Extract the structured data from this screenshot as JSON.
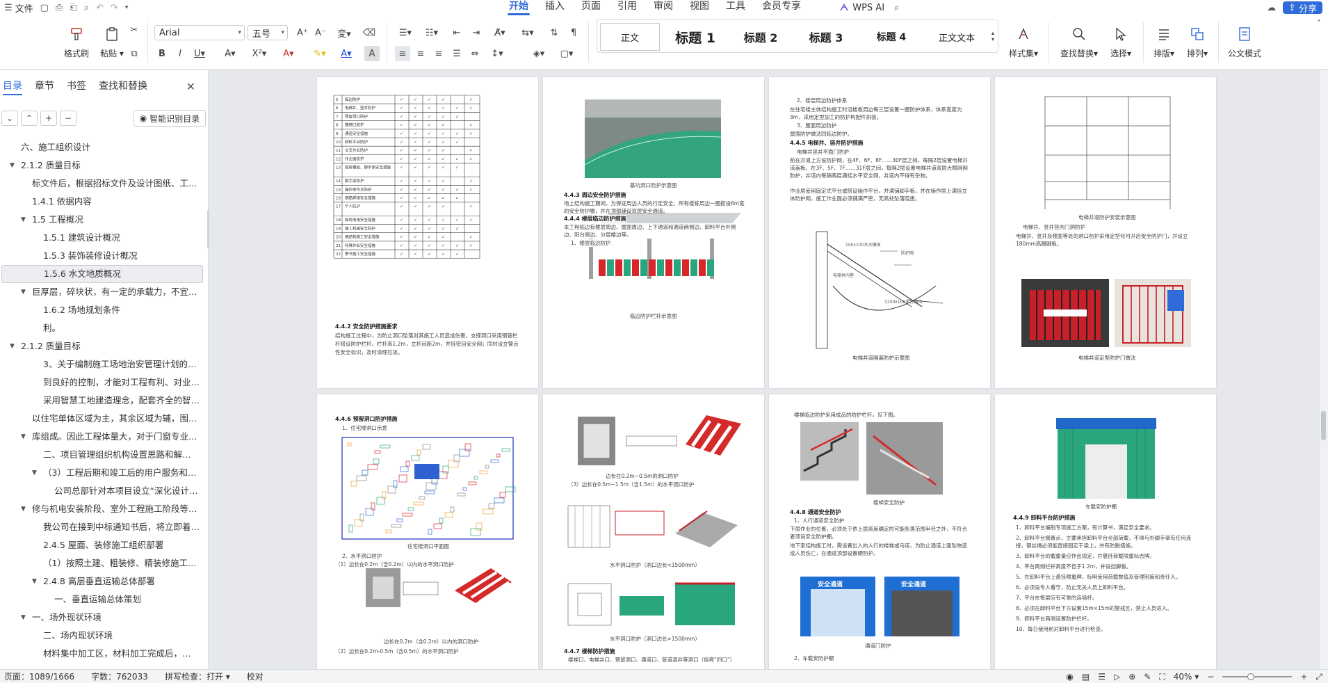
{
  "menu": {
    "file_label": "文件"
  },
  "tabs": [
    "开始",
    "插入",
    "页面",
    "引用",
    "审阅",
    "视图",
    "工具",
    "会员专享"
  ],
  "wps_ai_label": "WPS AI",
  "share_label": "分享",
  "ribbon": {
    "format_painter": "格式刷",
    "paste": "粘贴",
    "font_name": "Arial",
    "font_size": "五号",
    "styles": [
      "正文",
      "标题 1",
      "标题 2",
      "标题 3",
      "标题 4",
      "正文文本"
    ],
    "style_set": "样式集",
    "find_replace": "查找替换",
    "select": "选择",
    "layout": "排版",
    "arrange": "排列",
    "doc_mode": "公文模式"
  },
  "sidebar": {
    "tabs": [
      "目录",
      "章节",
      "书签",
      "查找和替换"
    ],
    "smart_toc": "智能识别目录",
    "toc": [
      {
        "text": "六、施工组织设计",
        "level": 1,
        "arrow": false
      },
      {
        "text": "2.1.2 质量目标",
        "level": 1,
        "arrow": true
      },
      {
        "text": "标文件后，根据招标文件及设计图纸、工程…",
        "level": 2,
        "arrow": false
      },
      {
        "text": "1.4.1 依据内容",
        "level": 2,
        "arrow": false
      },
      {
        "text": "1.5 工程概况",
        "level": 2,
        "arrow": true
      },
      {
        "text": "1.5.1 建筑设计概况",
        "level": 3,
        "arrow": false
      },
      {
        "text": "1.5.3 装饰装修设计概况",
        "level": 3,
        "arrow": false
      },
      {
        "text": "1.5.6 水文地质概况",
        "level": 3,
        "arrow": false,
        "selected": true
      },
      {
        "text": "巨厚层，碎块状，有一定的承载力，不宜作…",
        "level": 2,
        "arrow": true
      },
      {
        "text": "1.6.2 场地规划条件",
        "level": 3,
        "arrow": false
      },
      {
        "text": "利。",
        "level": 3,
        "arrow": false
      },
      {
        "text": "2.1.2 质量目标",
        "level": 1,
        "arrow": true
      },
      {
        "text": "3、关于编制施工场地治安管理计划的约…",
        "level": 3,
        "arrow": false
      },
      {
        "text": "到良好的控制，才能对工程有利、对业…",
        "level": 3,
        "arrow": false
      },
      {
        "text": "采用智慧工地建造理念，配套齐全的智…",
        "level": 3,
        "arrow": false
      },
      {
        "text": "以住宅单体区域为主，其余区域为辅，围绕…",
        "level": 2,
        "arrow": false
      },
      {
        "text": "库组成。因此工程体量大，对于门窗专业、…",
        "level": 2,
        "arrow": true
      },
      {
        "text": "二、项目管理组织机构设置思路和解…",
        "level": 3,
        "arrow": false
      },
      {
        "text": "（3）工程后期和竣工后的用户服务和保…",
        "level": 3,
        "arrow": true
      },
      {
        "text": "公司总部针对本项目设立“深化设计…",
        "level": 4,
        "arrow": false
      },
      {
        "text": "修与机电安装阶段、室外工程施工阶段等不…",
        "level": 2,
        "arrow": true
      },
      {
        "text": "我公司在接到中标通知书后，将立即着…",
        "level": 3,
        "arrow": false
      },
      {
        "text": "2.4.5 屋面、装修施工组织部署",
        "level": 3,
        "arrow": false
      },
      {
        "text": "（1）按照土建、粗装修、精装修施工进…",
        "level": 3,
        "arrow": false
      },
      {
        "text": "2.4.8 高层垂直运输总体部署",
        "level": 3,
        "arrow": true
      },
      {
        "text": "一、垂直运输总体策划",
        "level": 4,
        "arrow": false
      },
      {
        "text": "一、场外现状环境",
        "level": 2,
        "arrow": true
      },
      {
        "text": "二、场内现状环境",
        "level": 3,
        "arrow": false
      },
      {
        "text": "材料集中加工区，材料加工完成后，…",
        "level": 3,
        "arrow": false
      }
    ]
  },
  "pages": {
    "p1": {
      "rows": [
        "5",
        "6",
        "7",
        "8",
        "9",
        "10",
        "11",
        "12",
        "13",
        "14",
        "15",
        "16",
        "17",
        "18",
        "19",
        "20",
        "21",
        "22"
      ],
      "row_labels": [
        "临边防护",
        "电梯井、竖井防护",
        "预留洞口防护",
        "楼梯口防护",
        "通道安全措施",
        "卸料平台防护",
        "交叉作业防护",
        "作业面防护",
        "搭拆模板、脚手架安全措施",
        "脚手架防护",
        "操作架作业防护",
        "钢筋焊接安全措施",
        "个人防护",
        "临时用电安全措施",
        "施工机械安全防护",
        "钢结构施工安全措施",
        "特殊作业安全措施",
        "季节施工安全措施"
      ],
      "heading": "4.4.2 安全防护措施要求",
      "body": "结构施工过程中，为防止洞口坠落对其施工人员造成伤害，支撑洞口采用钢管栏杆搭设防护栏杆，栏杆高1.2m，立杆间距2m，并挂密目安全网；同时设立警示性安全标识，及时清理垃圾。"
    },
    "p2": {
      "caption1": "基坑洞口防护示意图",
      "h1": "4.4.3 周边安全防护措施",
      "t1": "地上结构施工期间，为保证周边人员的行走安全，所有楼栋周边一圈搭设6m宽的安全防护棚，并在顶部铺设双层安全通道。",
      "h2": "4.4.4 楼层临边防护措施",
      "t2": "本工程临边有楼层周边、屋面周边、上下通道和通道两侧边、卸料平台外侧边、阳台侧边、分层楼边等。",
      "sub": "1、楼层临边防护",
      "caption2": "临边防护栏杆示意图"
    },
    "p3": {
      "t1": "2、楼层周边防护体系",
      "t2": "在住宅楼主体结构施工时沿楼板周边每三层设置一圈防护体系，体系宽度为3m，采用定型加工的防护构配件拼装。",
      "t3": "3、屋面周边防护",
      "t4": "屋面防护做法同临边防护。",
      "h1": "4.4.5 电梯井、竖井防护措施",
      "t5": "电梯井竖井平面门防护",
      "t6": "前在井道上方设防护网，在4F、6F、8F……30F层之间，每隔2层设置电梯井道盖板。在3F、5F、7F……31F层之间，每隔2层设置电梯井道双层大眼网网防护，井道内每隔两层满挂水平安全网，井道内不得有杂物。",
      "t7": "作业层使用固定式平台或搭设操作平台，并满铺脚手板，并在操作层上满挂立体防护网，施工作业面必须铺满严密，无高处坠落隐患。",
      "caption": "电梯井道隔离防护示意图",
      "labels": [
        "100x100木方横挡",
        "防护网",
        "电梯井内壁",
        "1200x100木方横挡"
      ]
    },
    "p4": {
      "caption1": "电梯井道防护安装示意图",
      "t1": "电梯井、竖井竖向门洞防护",
      "t2": "电梯井、竖井及楼面等处的洞口防护采用定型化可开启安全防护门，并设立180mm高踢脚板。",
      "caption2": "电梯井道定型防护门做法"
    },
    "p5": {
      "h1": "4.4.6 预留洞口防护措施",
      "t1": "1、住宅楼洞口示意",
      "caption1": "住宅楼洞口平面图",
      "t2": "2、水平洞口防护",
      "t3": "（1）边长在0.2m（含0.2m）以内的水平洞口防护",
      "caption2": "边长在0.2m（含0.2m）以内的洞口防护",
      "t4": "（2）边长在0.2m-0.5m（含0.5m）的水平洞口防护"
    },
    "p6": {
      "caption1": "边长在0.2m~0.5m的洞口防护",
      "t1": "（3）边长在0.5m~1.5m（含1.5m）的水平洞口防护",
      "caption2": "水平洞口防护（洞口边长<1500mm）",
      "caption3": "水平洞口防护（洞口边长>1500mm）",
      "h1": "4.4.7 楼梯防护措施",
      "t2": "楼梯口、电梯井口、预留洞口、通道口、管道竖井等洞口（俗称“四口”）"
    },
    "p7": {
      "t1": "楼梯临边防护采用成品的防护栏杆，见下图。",
      "caption1": "楼梯安全防护",
      "h1": "4.4.8 通道安全防护",
      "t2": "1、人行通道安全防护",
      "t3": "下层作业的位置，必须处于依上层高度确定的可能坠落范围半径之外，不符合者须设安全防护棚。",
      "t4": "地下室结构施工时，需设置出入的人行的楼梯或马道，为防止通道上面坠物造成人员伤亡，在通道顶部设置硬防护。",
      "sign": "安全通道",
      "caption2": "通道门防护",
      "t5": "2、车载安防护棚"
    },
    "p8": {
      "caption1": "车载安防护棚",
      "h1": "4.4.9 卸料平台防护措施",
      "items": [
        "1、卸料平台编制专项施工方案，有计算书，满足安全要求。",
        "2、卸料平台搁置点，主要承担卸料平台全部荷载，不得与外脚手架有任何连接，钢丝绳必须能直接固定于梁上，并有防脱措施。",
        "3、卸料平台的载重量应作出规定，并悬挂荷载限重标志牌。",
        "4、平台两侧栏杆高度不低于1.2m，并设挡脚板。",
        "5、在卸料平台上悬挂限重牌，标明使用荷载数值及管理制度和责任人。",
        "6、必须设专人看守，防止无关人员上卸料平台。",
        "7、平台在每层应有可靠的连墙杆。",
        "8、必须在卸料平台下方设置15m×15m的警戒区，禁止人员进入。",
        "9、卸料平台两侧设置防护栏杆。",
        "10、每日使用前对卸料平台进行检查。"
      ]
    }
  },
  "status": {
    "page": "页面：1089/1666",
    "words": "字数：762033",
    "spell": "拼写检查：打开",
    "proof": "校对",
    "zoom": "40%"
  },
  "colors": {
    "accent": "#2f6bd9",
    "net_green": "#2aa67f",
    "warn_red": "#d9262a"
  }
}
